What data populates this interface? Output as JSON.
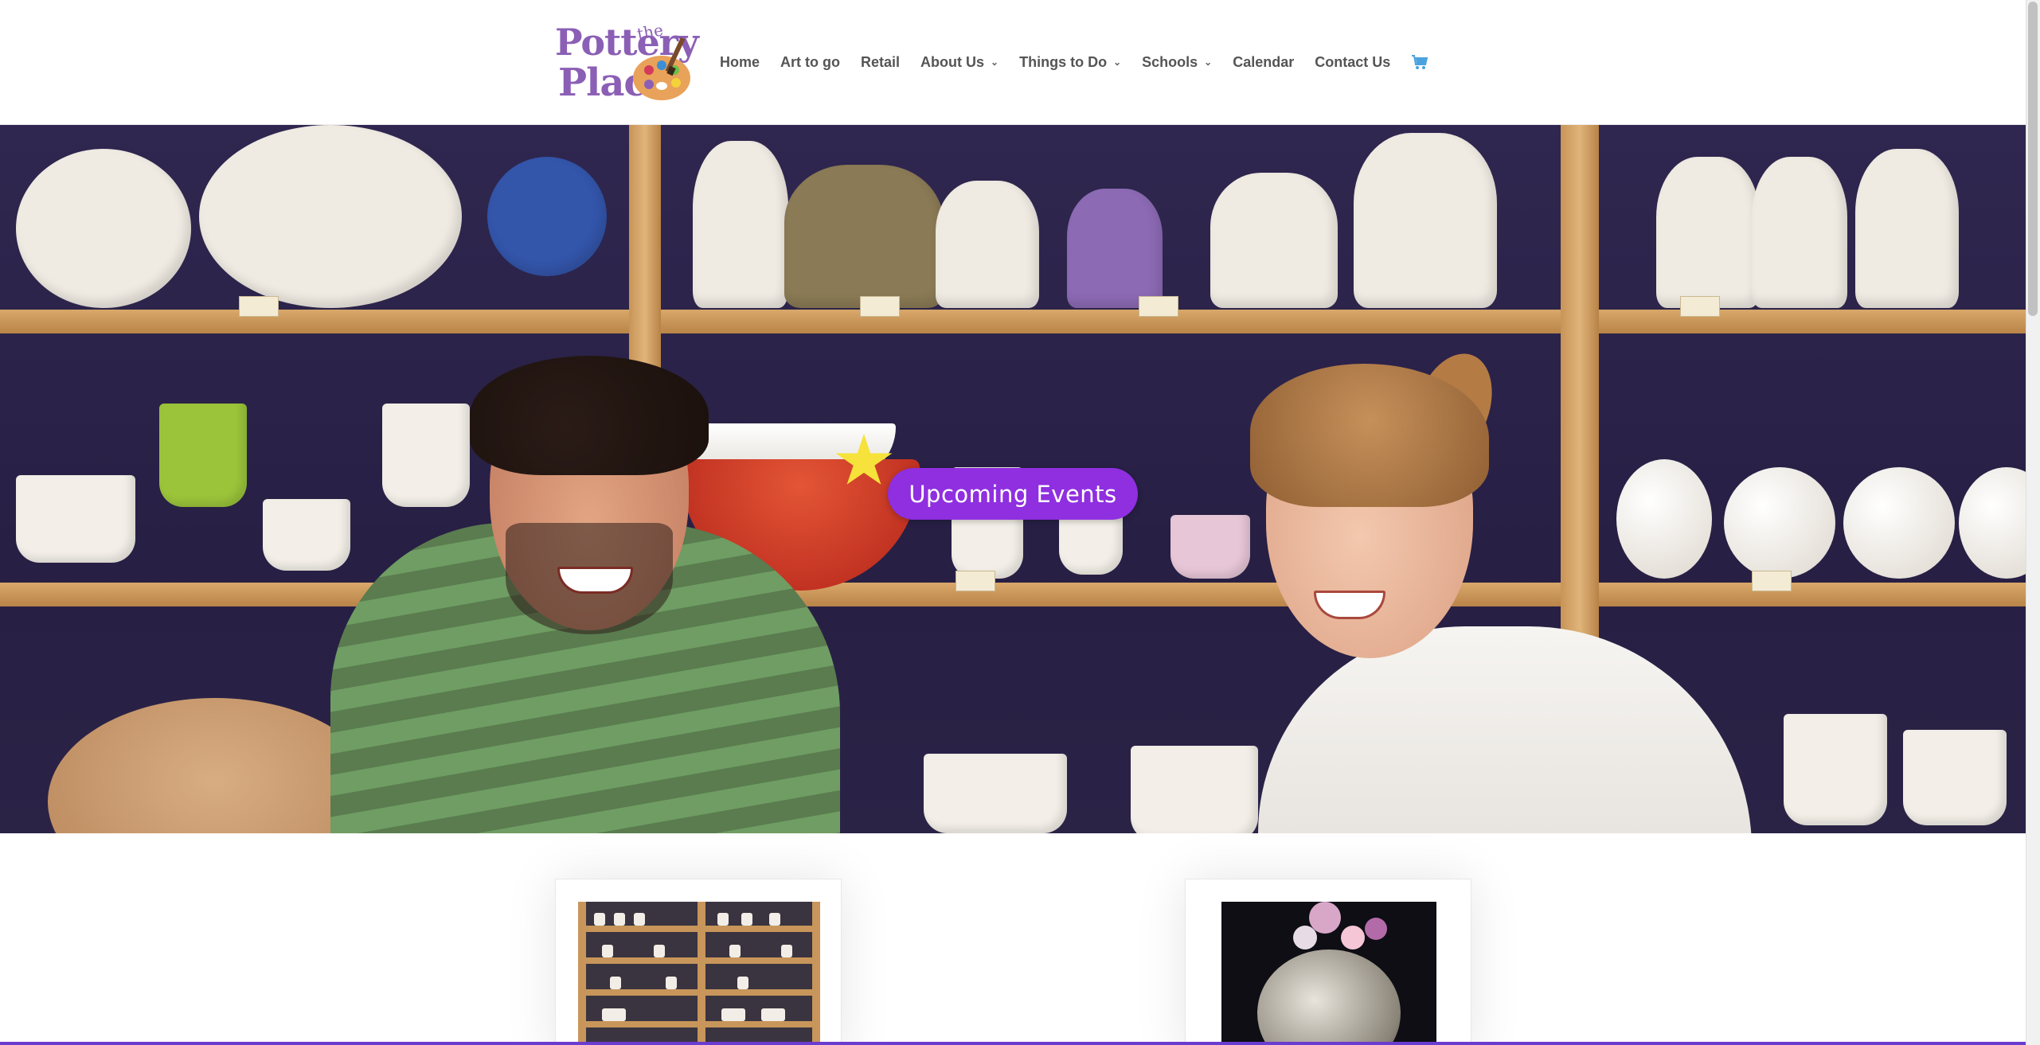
{
  "brand": {
    "logo_top": "the",
    "logo_line1": "Pottery",
    "logo_line2": "Place",
    "logo_alt": "The Pottery Place",
    "color": "#8b5fb5"
  },
  "nav": {
    "items": [
      {
        "label": "Home",
        "has_dropdown": false
      },
      {
        "label": "Art to go",
        "has_dropdown": false
      },
      {
        "label": "Retail",
        "has_dropdown": false
      },
      {
        "label": "About Us",
        "has_dropdown": true
      },
      {
        "label": "Things to Do",
        "has_dropdown": true
      },
      {
        "label": "Schools",
        "has_dropdown": true
      },
      {
        "label": "Calendar",
        "has_dropdown": false
      },
      {
        "label": "Contact Us",
        "has_dropdown": false
      }
    ],
    "cart_icon": "shopping-cart-icon",
    "cart_color": "#4aa3df"
  },
  "hero": {
    "cta_label": "Upcoming Events",
    "cta_color": "#8f2fe0"
  },
  "cards": [
    {
      "image": "pottery-shelves-photo"
    },
    {
      "image": "heart-pendant-photo"
    }
  ],
  "colors": {
    "accent": "#8f2fe0",
    "nav_text": "#555555"
  }
}
